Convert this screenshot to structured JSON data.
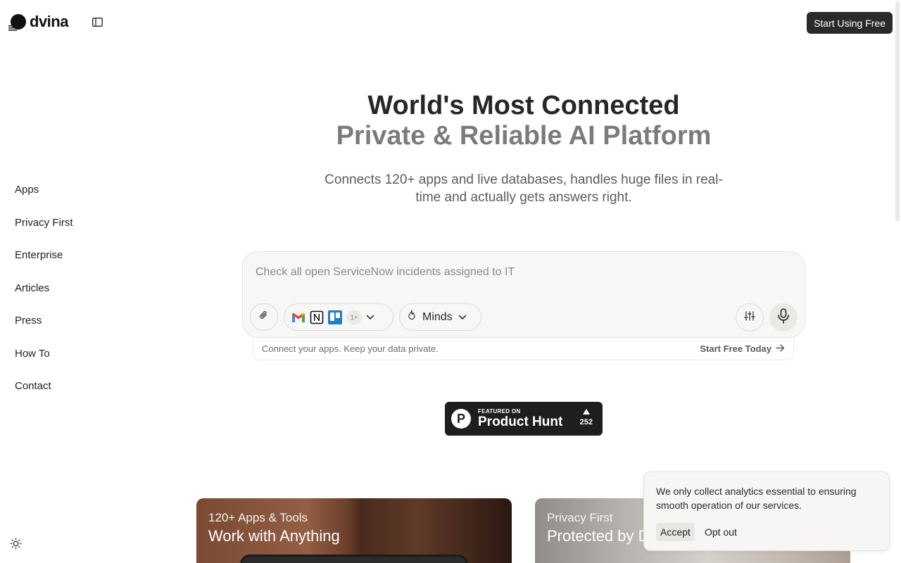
{
  "header": {
    "logo_text": "dvina",
    "cta_label": "Start Using Free"
  },
  "sidebar": {
    "items": [
      {
        "label": "Apps"
      },
      {
        "label": "Privacy First"
      },
      {
        "label": "Enterprise"
      },
      {
        "label": "Articles"
      },
      {
        "label": "Press"
      },
      {
        "label": "How To"
      },
      {
        "label": "Contact"
      }
    ]
  },
  "hero": {
    "title_line1": "World's Most Connected",
    "title_line2": "Private & Reliable AI Platform",
    "subtitle": "Connects 120+ apps and live databases, handles huge files in real-time and actually gets answers right."
  },
  "composer": {
    "placeholder": "Check all open ServiceNow incidents assigned to IT",
    "apps_more_count": "1+",
    "minds_label": "Minds",
    "footer_note": "Connect your apps. Keep your data private.",
    "footer_cta": "Start Free Today"
  },
  "product_hunt": {
    "featured_label": "FEATURED ON",
    "name": "Product Hunt",
    "votes": "252"
  },
  "cards": [
    {
      "label": "120+ Apps & Tools",
      "title": "Work with Anything"
    },
    {
      "label": "Privacy First",
      "title": "Protected by D"
    }
  ],
  "cookie_banner": {
    "text": "We only collect analytics essential to ensuring smooth operation of our services.",
    "accept_label": "Accept",
    "optout_label": "Opt out"
  },
  "colors": {
    "accent_dark": "#2a2a2a",
    "composer_bg": "#f8f7f6",
    "muted_text": "#7b7b7b"
  },
  "icons": [
    "logo-mark-icon",
    "sidebar-toggle-icon",
    "sun-icon",
    "paperclip-icon",
    "gmail-icon",
    "notion-icon",
    "trello-icon",
    "chevron-down-icon",
    "flame-icon",
    "sliders-icon",
    "microphone-icon",
    "arrow-right-icon",
    "product-hunt-icon",
    "upvote-icon"
  ]
}
